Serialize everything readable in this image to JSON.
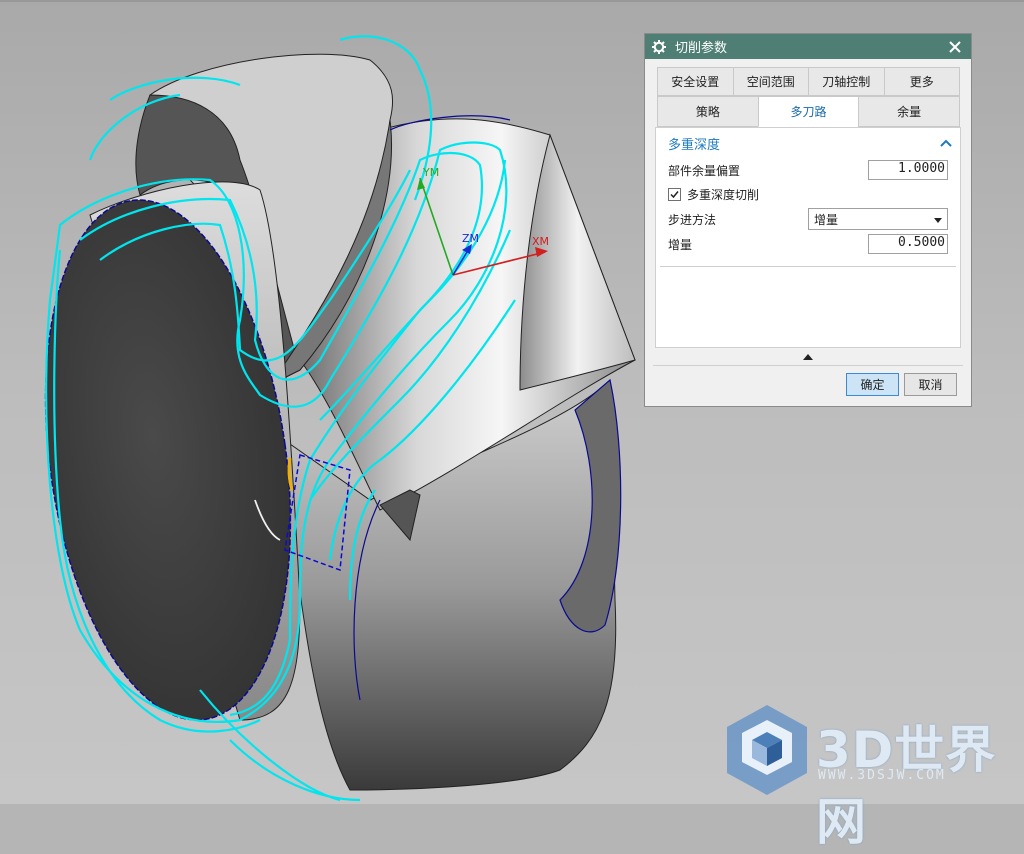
{
  "viewport": {
    "axes": {
      "x": "XM",
      "y": "YM",
      "z": "ZM"
    }
  },
  "dialog": {
    "title": "切削参数",
    "tabs_row1": [
      "安全设置",
      "空间范围",
      "刀轴控制",
      "更多"
    ],
    "tabs_row2": [
      "策略",
      "多刀路",
      "余量"
    ],
    "active_tab": "多刀路",
    "section": {
      "title": "多重深度"
    },
    "fields": {
      "part_stock_offset_label": "部件余量偏置",
      "part_stock_offset_value": "1.0000",
      "multi_depth_label": "多重深度切削",
      "multi_depth_checked": true,
      "step_method_label": "步进方法",
      "step_method_value": "增量",
      "increment_label": "增量",
      "increment_value": "0.5000"
    },
    "buttons": {
      "ok": "确定",
      "cancel": "取消"
    }
  },
  "watermark": {
    "text": "3D世界网",
    "url": "WWW.3DSJW.COM"
  },
  "colors": {
    "titlebar": "#4f7f74",
    "toolpath": "#00e5ee",
    "accent": "#1e7bbf",
    "background": "#b5b5b5"
  }
}
